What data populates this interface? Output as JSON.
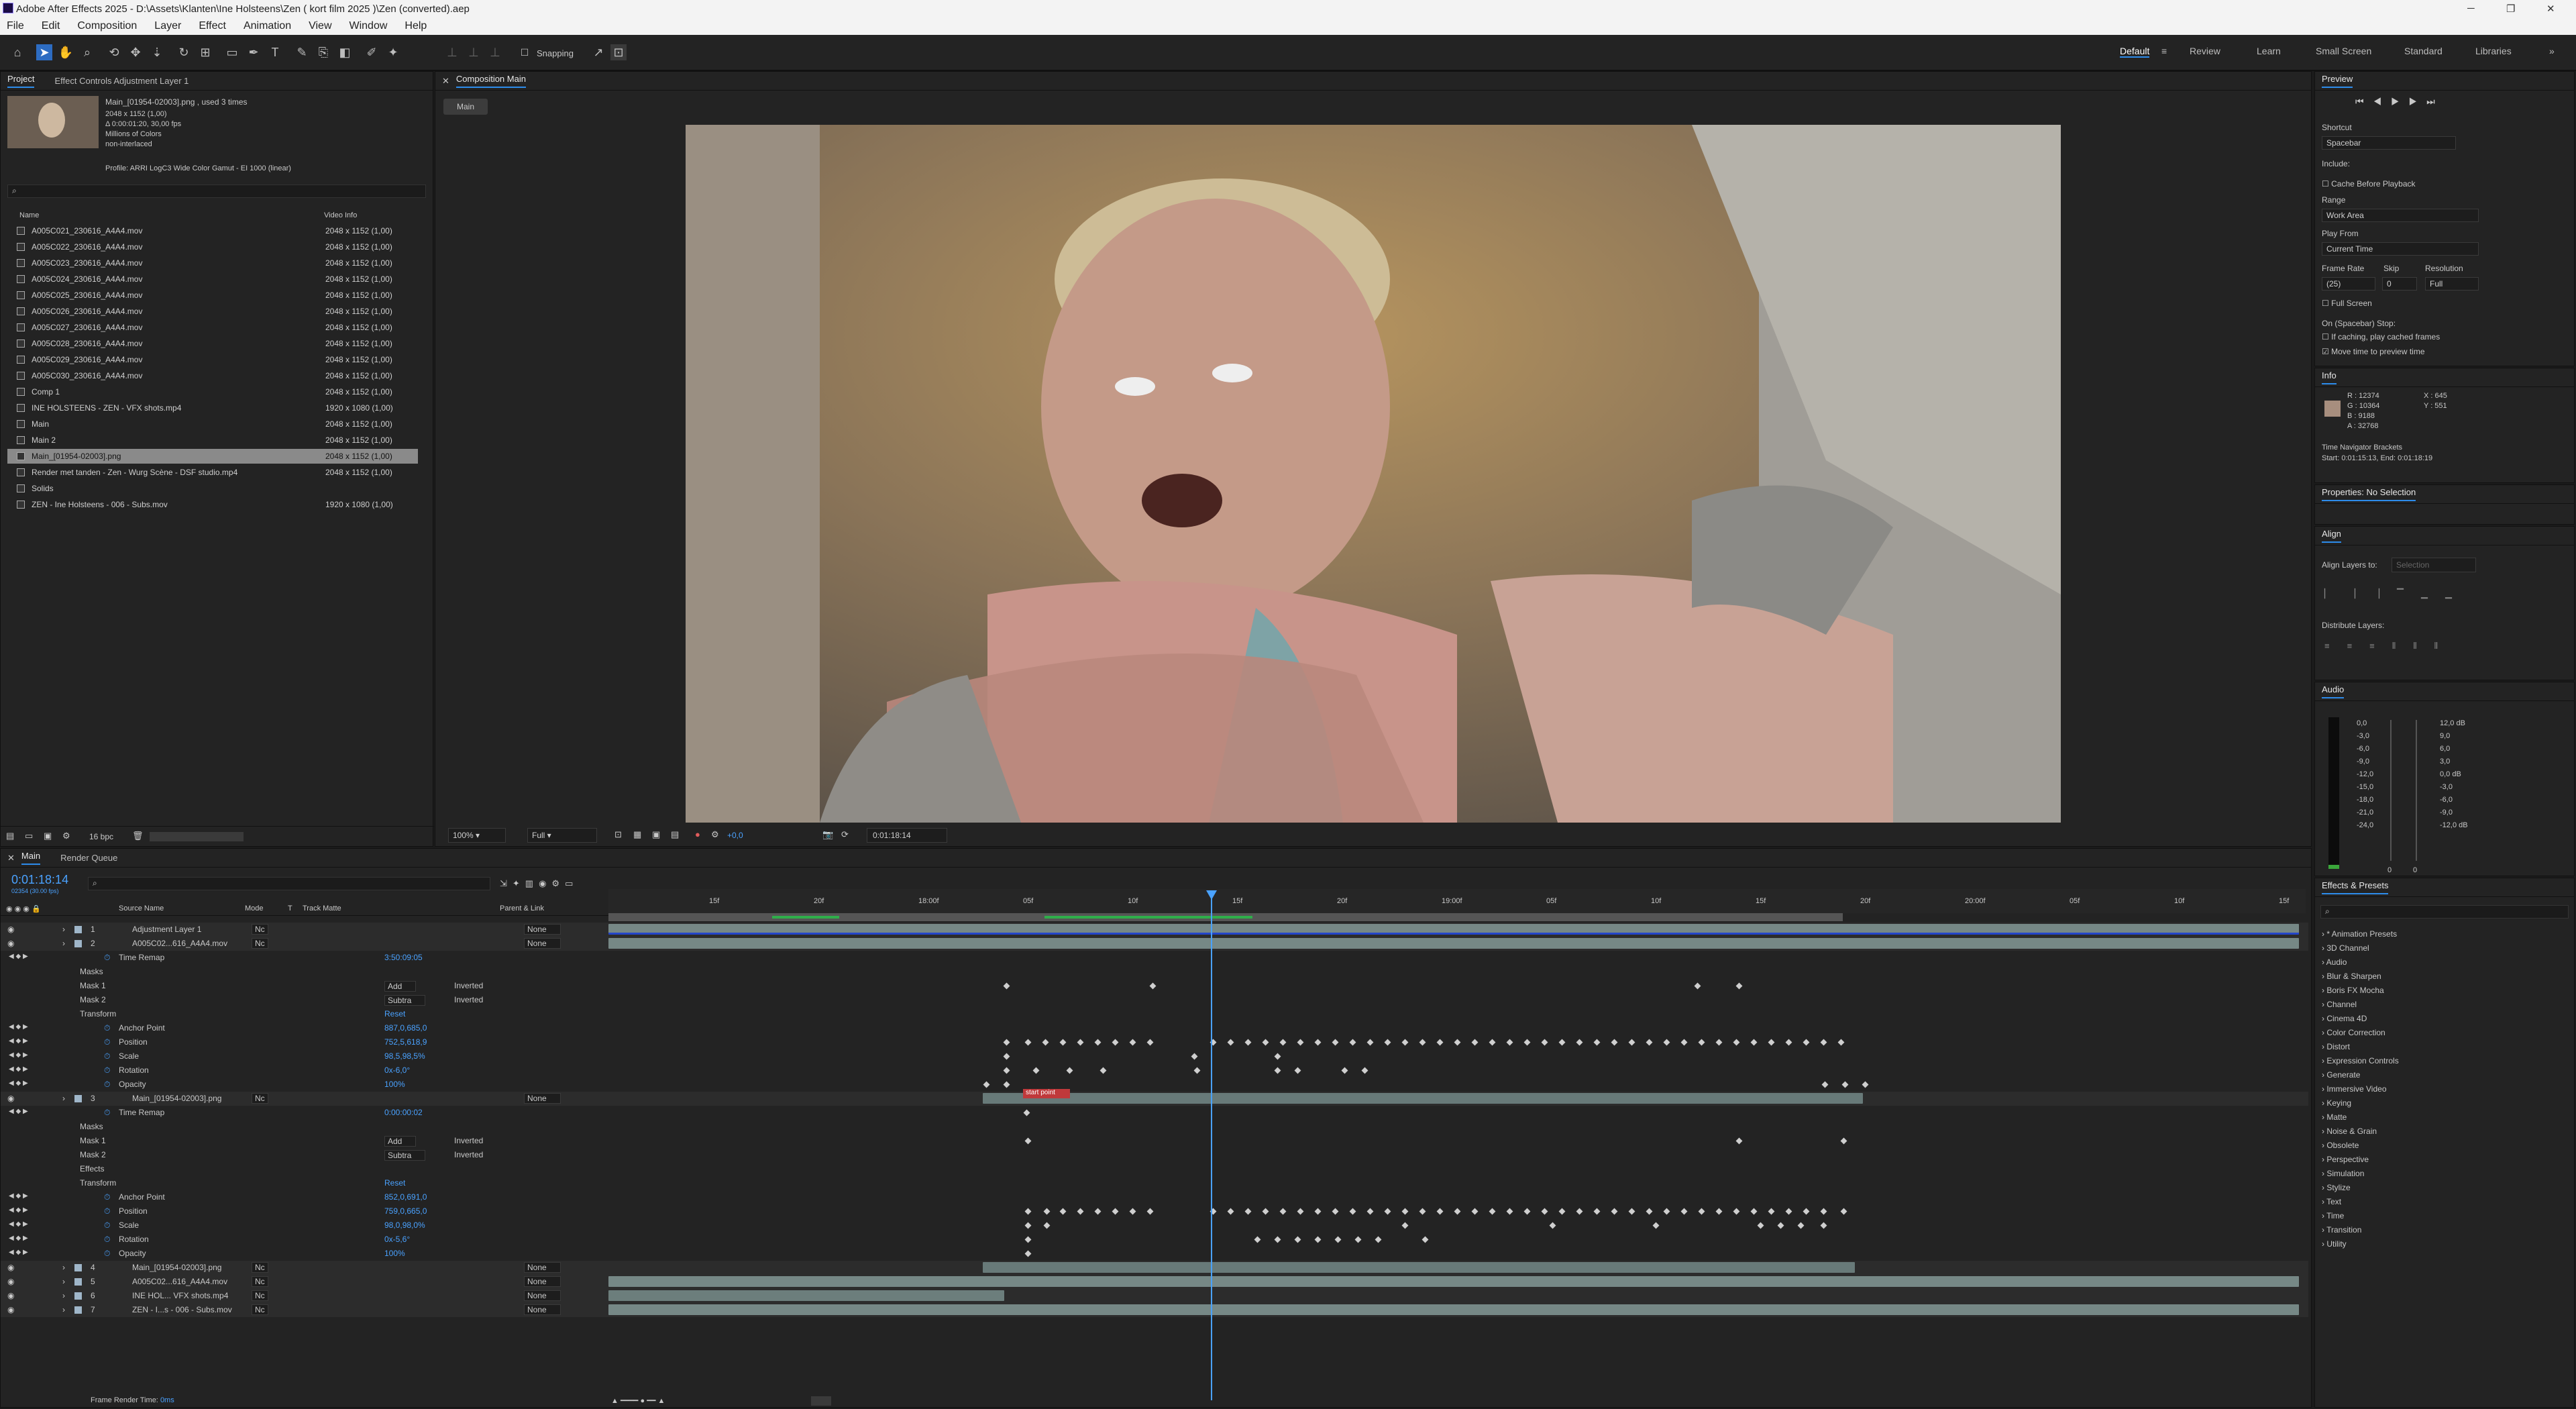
{
  "titlebar": {
    "title": "Adobe After Effects 2025 - D:\\Assets\\Klanten\\Ine Holsteens\\Zen ( kort film 2025 )\\Zen (converted).aep"
  },
  "menu": [
    "File",
    "Edit",
    "Composition",
    "Layer",
    "Effect",
    "Animation",
    "View",
    "Window",
    "Help"
  ],
  "toolbar": {
    "snapping": "Snapping",
    "workspaces": [
      "Default",
      "Review",
      "Learn",
      "Small Screen",
      "Standard",
      "Libraries"
    ]
  },
  "project": {
    "tabs": [
      "Project",
      "Effect Controls Adjustment Layer 1"
    ],
    "selected_name": "Main_[01954-02003].png",
    "used": ", used 3 times",
    "info": [
      "2048 x 1152 (1,00)",
      "Δ 0:00:01:20, 30,00 fps",
      "Millions of Colors",
      "non-interlaced"
    ],
    "profile": "Profile: ARRI LogC3 Wide Color Gamut - EI 1000 (linear)",
    "columns": {
      "name": "Name",
      "video": "Video Info"
    },
    "items": [
      {
        "name": "A005C021_230616_A4A4.mov",
        "info": "2048 x 1152 (1,00)"
      },
      {
        "name": "A005C022_230616_A4A4.mov",
        "info": "2048 x 1152 (1,00)"
      },
      {
        "name": "A005C023_230616_A4A4.mov",
        "info": "2048 x 1152 (1,00)"
      },
      {
        "name": "A005C024_230616_A4A4.mov",
        "info": "2048 x 1152 (1,00)"
      },
      {
        "name": "A005C025_230616_A4A4.mov",
        "info": "2048 x 1152 (1,00)"
      },
      {
        "name": "A005C026_230616_A4A4.mov",
        "info": "2048 x 1152 (1,00)"
      },
      {
        "name": "A005C027_230616_A4A4.mov",
        "info": "2048 x 1152 (1,00)"
      },
      {
        "name": "A005C028_230616_A4A4.mov",
        "info": "2048 x 1152 (1,00)"
      },
      {
        "name": "A005C029_230616_A4A4.mov",
        "info": "2048 x 1152 (1,00)"
      },
      {
        "name": "A005C030_230616_A4A4.mov",
        "info": "2048 x 1152 (1,00)"
      },
      {
        "name": "Comp 1",
        "info": "2048 x 1152 (1,00)"
      },
      {
        "name": "INE HOLSTEENS - ZEN - VFX shots.mp4",
        "info": "1920 x 1080 (1,00)"
      },
      {
        "name": "Main",
        "info": "2048 x 1152 (1,00)"
      },
      {
        "name": "Main 2",
        "info": "2048 x 1152 (1,00)"
      },
      {
        "name": "Main_[01954-02003].png",
        "info": "2048 x 1152 (1,00)"
      },
      {
        "name": "Render met tanden - Zen - Wurg Scène - DSF studio.mp4",
        "info": "2048 x 1152 (1,00)"
      },
      {
        "name": "Solids",
        "info": ""
      },
      {
        "name": "ZEN - Ine Holsteens - 006 - Subs.mov",
        "info": "1920 x 1080 (1,00)"
      }
    ],
    "bpc": "16 bpc"
  },
  "composition": {
    "tab": "Composition Main",
    "crumb": "Main",
    "zoom": "100%",
    "quality": "Full",
    "time": "0:01:18:14",
    "exposure": "+0,0"
  },
  "timeline": {
    "tabs": [
      "Main",
      "Render Queue"
    ],
    "timecode": "0:01:18:14",
    "fps": "02354 (30.00 fps)",
    "cols": [
      "Source Name",
      "Mode",
      "T",
      "Track Matte",
      "Parent & Link"
    ],
    "ruler": [
      "15f",
      "20f",
      "18:00f",
      "05f",
      "10f",
      "15f",
      "20f",
      "19:00f",
      "05f",
      "10f",
      "15f",
      "20f",
      "20:00f",
      "05f",
      "10f",
      "15f"
    ],
    "rows": [
      {
        "n": "1",
        "name": "Adjustment Layer 1",
        "mode": "Nc",
        "parent": "None"
      },
      {
        "n": "2",
        "name": "A005C02...616_A4A4.mov",
        "mode": "Nc",
        "parent": "None"
      },
      {
        "name": "Time Remap",
        "val": "3:50:09:05"
      },
      {
        "name": "Masks"
      },
      {
        "name": "Mask 1",
        "val": "Add",
        "inv": "Inverted"
      },
      {
        "name": "Mask 2",
        "val": "Subtra",
        "inv": "Inverted"
      },
      {
        "name": "Transform",
        "val": "Reset"
      },
      {
        "name": "Anchor Point",
        "val": "887,0,685,0"
      },
      {
        "name": "Position",
        "val": "752,5,618,9"
      },
      {
        "name": "Scale",
        "val": "98,5,98,5%"
      },
      {
        "name": "Rotation",
        "val": "0x-6,0°"
      },
      {
        "name": "Opacity",
        "val": "100%"
      },
      {
        "n": "3",
        "name": "Main_[01954-02003].png",
        "mode": "Nc",
        "parent": "None"
      },
      {
        "name": "Time Remap",
        "val": "0:00:00:02"
      },
      {
        "name": "Masks"
      },
      {
        "name": "Mask 1",
        "val": "Add",
        "inv": "Inverted"
      },
      {
        "name": "Mask 2",
        "val": "Subtra",
        "inv": "Inverted"
      },
      {
        "name": "Effects"
      },
      {
        "name": "Transform",
        "val": "Reset"
      },
      {
        "name": "Anchor Point",
        "val": "852,0,691,0"
      },
      {
        "name": "Position",
        "val": "759,0,665,0"
      },
      {
        "name": "Scale",
        "val": "98,0,98,0%"
      },
      {
        "name": "Rotation",
        "val": "0x-5,6°"
      },
      {
        "name": "Opacity",
        "val": "100%"
      },
      {
        "n": "4",
        "name": "Main_[01954-02003].png",
        "mode": "Nc",
        "parent": "None"
      },
      {
        "n": "5",
        "name": "A005C02...616_A4A4.mov",
        "mode": "Nc",
        "parent": "None"
      },
      {
        "n": "6",
        "name": "INE HOL... VFX shots.mp4",
        "mode": "Nc",
        "parent": "None"
      },
      {
        "n": "7",
        "name": "ZEN - I...s - 006 - Subs.mov",
        "mode": "Nc",
        "parent": "None"
      }
    ],
    "startpoint": "start point",
    "render_time_label": "Frame Render Time:",
    "render_time": "0ms"
  },
  "preview": {
    "title": "Preview",
    "shortcut": "Shortcut",
    "shortcut_val": "Spacebar",
    "include": "Include:",
    "cache": "Cache Before Playback",
    "range": "Range",
    "range_val": "Work Area",
    "playfrom": "Play From",
    "playfrom_val": "Current Time",
    "fr": "Frame Rate",
    "skip": "Skip",
    "res": "Resolution",
    "fr_val": "(25)",
    "skip_val": "0",
    "res_val": "Full",
    "fullscreen": "Full Screen",
    "onstop": "On (Spacebar) Stop:",
    "ifcaching": "If caching, play cached frames",
    "movetime": "Move time to preview time"
  },
  "info": {
    "title": "Info",
    "r": "R : 12374",
    "g": "G : 10364",
    "b": "B : 9188",
    "a": "A : 32768",
    "x": "X : 645",
    "y": "Y : 551",
    "nav": "Time Navigator Brackets",
    "nav_val": "Start: 0:01:15:13, End: 0:01:18:19",
    "swatch": "#a78e7e"
  },
  "properties": {
    "title": "Properties: No Selection"
  },
  "align": {
    "title": "Align",
    "to": "Align Layers to:",
    "to_val": "Selection",
    "dist": "Distribute Layers:"
  },
  "audio": {
    "title": "Audio",
    "left": [
      "0,0",
      "-3,0",
      "-6,0",
      "-9,0",
      "-12,0",
      "-15,0",
      "-18,0",
      "-21,0",
      "-24,0"
    ],
    "right": [
      "12,0 dB",
      "9,0",
      "6,0",
      "3,0",
      "0,0 dB",
      "-3,0",
      "-6,0",
      "-9,0",
      "-12,0 dB"
    ],
    "zero1": "0",
    "zero2": "0"
  },
  "effects": {
    "title": "Effects & Presets",
    "items": [
      "* Animation Presets",
      "3D Channel",
      "Audio",
      "Blur & Sharpen",
      "Boris FX Mocha",
      "Channel",
      "Cinema 4D",
      "Color Correction",
      "Distort",
      "Expression Controls",
      "Generate",
      "Immersive Video",
      "Keying",
      "Matte",
      "Noise & Grain",
      "Obsolete",
      "Perspective",
      "Simulation",
      "Stylize",
      "Text",
      "Time",
      "Transition",
      "Utility"
    ]
  }
}
